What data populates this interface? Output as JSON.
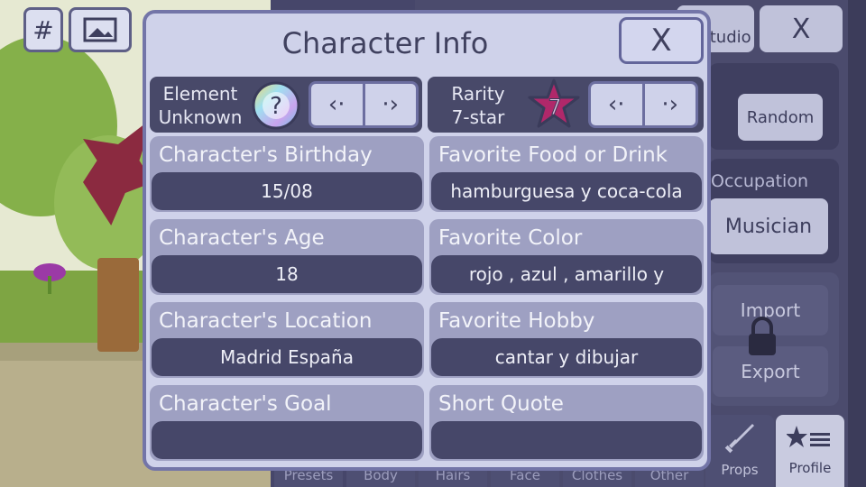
{
  "background": {
    "toolbar": {
      "grid_label": "#"
    },
    "profile_button_label": "Profile",
    "camera_label": "Studio",
    "close_label": "X",
    "random_button_label": "Random",
    "occupation_label": "Occupation",
    "occupation_value": "Musician",
    "import_label": "Import",
    "export_label": "Export",
    "tabs": [
      {
        "label": "Presets"
      },
      {
        "label": "Body"
      },
      {
        "label": "Hairs"
      },
      {
        "label": "Face"
      },
      {
        "label": "Clothes"
      },
      {
        "label": "Other"
      },
      {
        "label": "Props"
      },
      {
        "label": "Profile"
      }
    ]
  },
  "modal": {
    "title": "Character Info",
    "close_label": "X",
    "element": {
      "label_line1": "Element",
      "label_line2": "Unknown",
      "icon_glyph": "?"
    },
    "rarity": {
      "label_line1": "Rarity",
      "label_line2": "7-star",
      "icon_glyph": "7"
    },
    "arrows": {
      "prev": "‹·",
      "next": "·›"
    },
    "fields": {
      "birthday": {
        "label": "Character's Birthday",
        "value": "15/08"
      },
      "age": {
        "label": "Character's Age",
        "value": "18"
      },
      "location": {
        "label": "Character's Location",
        "value": "Madrid España"
      },
      "goal": {
        "label": "Character's Goal",
        "value": ""
      },
      "food": {
        "label": "Favorite Food or Drink",
        "value": "hamburguesa y coca-cola"
      },
      "color": {
        "label": "Favorite Color",
        "value": "rojo , azul , amarillo y"
      },
      "hobby": {
        "label": "Favorite Hobby",
        "value": "cantar y dibujar"
      },
      "quote": {
        "label": "Short Quote",
        "value": ""
      }
    }
  },
  "colors": {
    "modal_bg": "#cfd2ea",
    "modal_border": "#7375a8",
    "field_bg": "#9ea0c2",
    "value_bg": "#464769",
    "star": "#b0286a"
  }
}
